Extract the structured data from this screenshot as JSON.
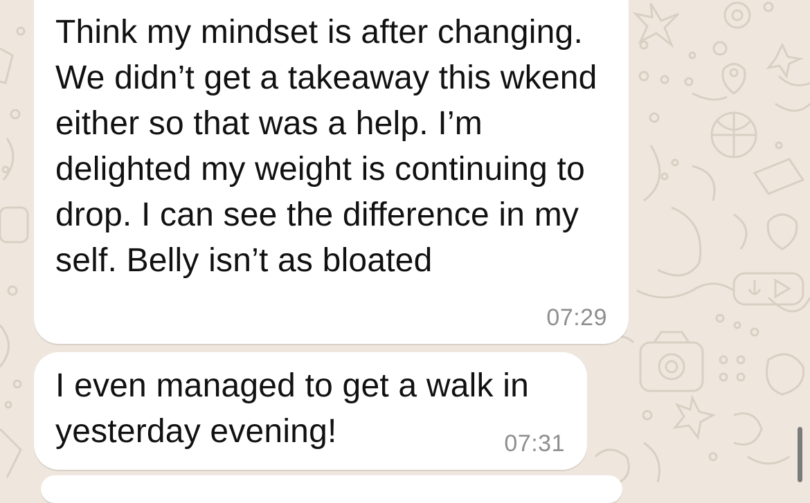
{
  "chat": {
    "background_color": "#efe7de",
    "bubble_color": "#ffffff",
    "messages": [
      {
        "text": "Think my mindset is after changing. We didn’t get a takeaway this wkend either so that was a help. I’m delighted my weight is continuing to drop. I can see the difference in my self. Belly isn’t as bloated",
        "time": "07:29"
      },
      {
        "text": "I even managed to get a walk in yesterday evening!",
        "time": "07:31"
      }
    ]
  }
}
